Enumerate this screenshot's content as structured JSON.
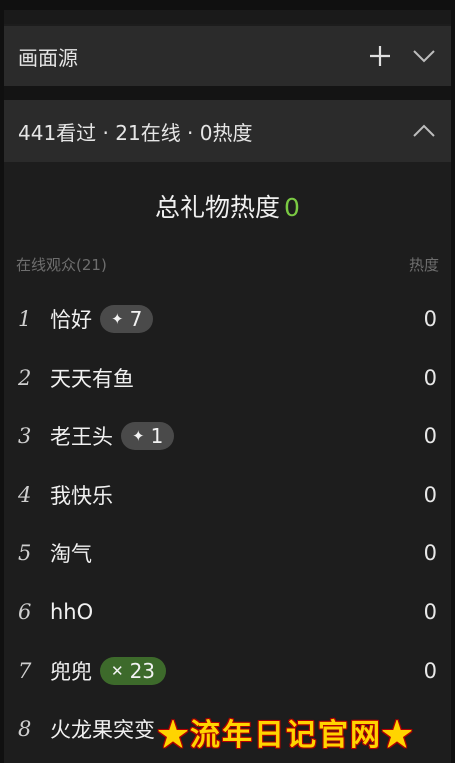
{
  "source_panel": {
    "title": "画面源"
  },
  "stats_panel": {
    "summary": "441看过 · 21在线 · 0热度"
  },
  "gift_heat": {
    "label": "总礼物热度",
    "value": "0"
  },
  "columns": {
    "audience": "在线观众(21)",
    "heat": "热度"
  },
  "rows": [
    {
      "rank": "1",
      "name": "恰好",
      "badge": "7",
      "badge_icon": "sparkle-icon",
      "badge_color": "#4a4a4a",
      "heat": "0"
    },
    {
      "rank": "2",
      "name": "天天有鱼",
      "heat": "0"
    },
    {
      "rank": "3",
      "name": "老王头",
      "badge": "1",
      "badge_icon": "sparkle-icon",
      "badge_color": "#4a4a4a",
      "heat": "0"
    },
    {
      "rank": "4",
      "name": "我快乐",
      "heat": "0"
    },
    {
      "rank": "5",
      "name": "淘气",
      "heat": "0"
    },
    {
      "rank": "6",
      "name": "hhO",
      "heat": "0"
    },
    {
      "rank": "7",
      "name": "兜兜",
      "badge": "23",
      "badge_icon": "sparkle-cross-icon",
      "badge_color": "#3d6a2b",
      "heat": "0"
    },
    {
      "rank": "8",
      "name": "火龙果突变",
      "heat": ""
    }
  ],
  "watermark": {
    "text": "★流年日记官网★"
  },
  "colors": {
    "accent_green": "#7ac943",
    "panel_bg": "#1d1d1d",
    "header_bg": "#2b2b2b"
  }
}
